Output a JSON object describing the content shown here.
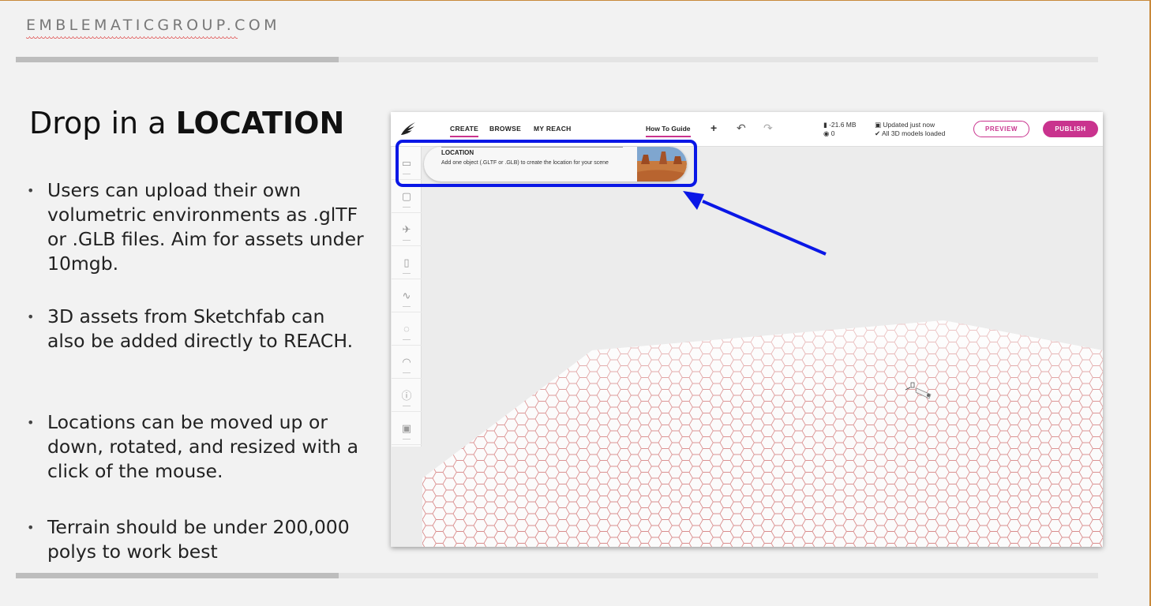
{
  "slide": {
    "brand": "EMBLEMATICGROUP.COM",
    "title_prefix": "Drop in a ",
    "title_bold": "LOCATION",
    "bullets": [
      "Users can upload their own volumetric environments as .glTF or .GLB files. Aim for assets under 10mgb.",
      "3D assets from Sketchfab can also be added directly to REACH.",
      "Locations  can be moved up or down, rotated, and resized with a click of the mouse.",
      "Terrain should be under 200,000 polys to work best"
    ],
    "accent_color": "#c8893a",
    "highlight_color": "#0a17e6"
  },
  "app": {
    "logo_icon": "wing-logo-icon",
    "nav": [
      "CREATE",
      "BROWSE",
      "MY REACH"
    ],
    "active_nav": "CREATE",
    "how_to_guide": "How To Guide",
    "toolbar_icons": [
      "plus-icon",
      "undo-icon",
      "redo-icon"
    ],
    "stats": {
      "size": "-21.6 MB",
      "views": "0",
      "updated": "Updated just now",
      "models": "All 3D models loaded"
    },
    "preview_label": "PREVIEW",
    "publish_label": "PUBLISH",
    "brand_color": "#c9338e",
    "sidebar_icons": [
      "location-icon",
      "object-icon",
      "satellite-icon",
      "text-icon",
      "audio-icon",
      "light-icon",
      "rainbow-icon",
      "info-icon",
      "image-icon"
    ],
    "location_card": {
      "title": "LOCATION",
      "description": "Add one object (.GLTF or .GLB) to create the location for your scene"
    }
  }
}
